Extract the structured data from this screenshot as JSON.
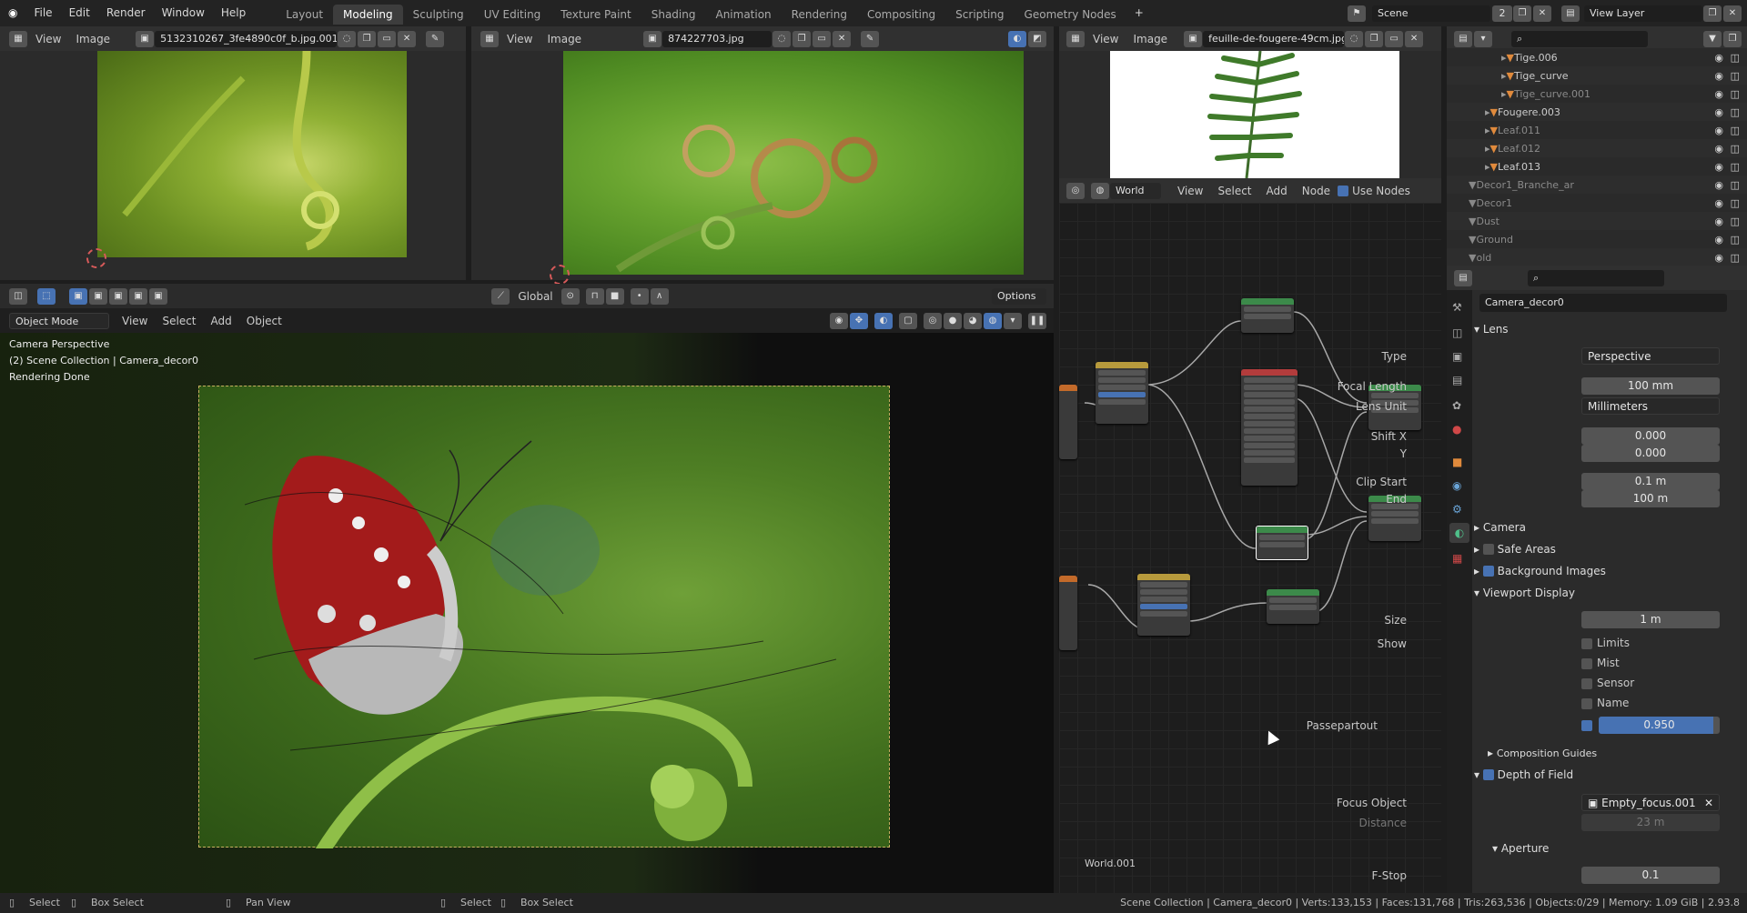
{
  "menu": {
    "file": "File",
    "edit": "Edit",
    "render": "Render",
    "window": "Window",
    "help": "Help"
  },
  "workspaces": [
    "Layout",
    "Modeling",
    "Sculpting",
    "UV Editing",
    "Texture Paint",
    "Shading",
    "Animation",
    "Rendering",
    "Compositing",
    "Scripting",
    "Geometry Nodes"
  ],
  "add_workspace": "+",
  "scene": {
    "name": "Scene",
    "count": "2",
    "view_layer": "View Layer"
  },
  "img_editor1": {
    "view": "View",
    "image": "Image",
    "filename": "5132310267_3fe4890c0f_b.jpg.001"
  },
  "img_editor2": {
    "view": "View",
    "image": "Image",
    "filename": "874227703.jpg"
  },
  "img_editor3": {
    "view": "View",
    "image": "Image",
    "filename": "feuille-de-fougere-49cm.jpg"
  },
  "viewport": {
    "transform": "Global",
    "options": "Options",
    "mode": "Object Mode",
    "view": "View",
    "select": "Select",
    "add": "Add",
    "object": "Object",
    "info1": "Camera Perspective",
    "info2": "(2) Scene Collection | Camera_decor0",
    "info3": "Rendering Done"
  },
  "node_editor": {
    "world": "World",
    "view": "View",
    "select": "Select",
    "add": "Add",
    "node": "Node",
    "use_nodes": "Use Nodes",
    "world_name": "World.001"
  },
  "outliner": {
    "items": [
      {
        "name": "Tige.006",
        "indent": 3,
        "dim": false,
        "color": "#e08a3c"
      },
      {
        "name": "Tige_curve",
        "indent": 3,
        "dim": false,
        "color": "#e08a3c"
      },
      {
        "name": "Tige_curve.001",
        "indent": 3,
        "dim": true,
        "color": "#e08a3c"
      },
      {
        "name": "Fougere.003",
        "indent": 2,
        "dim": false,
        "color": "#e08a3c"
      },
      {
        "name": "Leaf.011",
        "indent": 2,
        "dim": true,
        "color": "#e08a3c"
      },
      {
        "name": "Leaf.012",
        "indent": 2,
        "dim": true,
        "color": "#e08a3c"
      },
      {
        "name": "Leaf.013",
        "indent": 2,
        "dim": false,
        "color": "#e08a3c"
      },
      {
        "name": "Decor1_Branche_ar",
        "indent": 1,
        "dim": true,
        "color": "#888"
      },
      {
        "name": "Decor1",
        "indent": 1,
        "dim": true,
        "color": "#888"
      },
      {
        "name": "Dust",
        "indent": 1,
        "dim": true,
        "color": "#888"
      },
      {
        "name": "Ground",
        "indent": 1,
        "dim": true,
        "color": "#888"
      },
      {
        "name": "old",
        "indent": 1,
        "dim": true,
        "color": "#888"
      }
    ]
  },
  "properties": {
    "object_name": "Camera_decor0",
    "lens_section": "Lens",
    "type_label": "Type",
    "type_value": "Perspective",
    "focal_label": "Focal Length",
    "focal_value": "100 mm",
    "unit_label": "Lens Unit",
    "unit_value": "Millimeters",
    "shiftx_label": "Shift X",
    "shiftx_value": "0.000",
    "shifty_label": "Y",
    "shifty_value": "0.000",
    "clipstart_label": "Clip Start",
    "clipstart_value": "0.1 m",
    "clipend_label": "End",
    "clipend_value": "100 m",
    "camera_section": "Camera",
    "safe_areas": "Safe Areas",
    "bg_images": "Background Images",
    "viewport_display": "Viewport Display",
    "size_label": "Size",
    "size_value": "1 m",
    "show_label": "Show",
    "limits": "Limits",
    "mist": "Mist",
    "sensor": "Sensor",
    "name": "Name",
    "passepartout_label": "Passepartout",
    "passepartout_value": "0.950",
    "passepartout_fraction": 0.95,
    "composition_guides": "Composition Guides",
    "dof_section": "Depth of Field",
    "focus_label": "Focus Object",
    "focus_value": "Empty_focus.001",
    "distance_label": "Distance",
    "distance_value": "23 m",
    "aperture_section": "Aperture",
    "fstop_label": "F-Stop",
    "fstop_value": "0.1"
  },
  "status": {
    "select": "Select",
    "box_select": "Box Select",
    "pan_view": "Pan View",
    "select2": "Select",
    "box_select2": "Box Select",
    "info": "Scene Collection | Camera_decor0 | Verts:133,153 | Faces:131,768 | Tris:263,536 | Objects:0/29 | Memory: 1.09 GiB | 2.93.8"
  }
}
